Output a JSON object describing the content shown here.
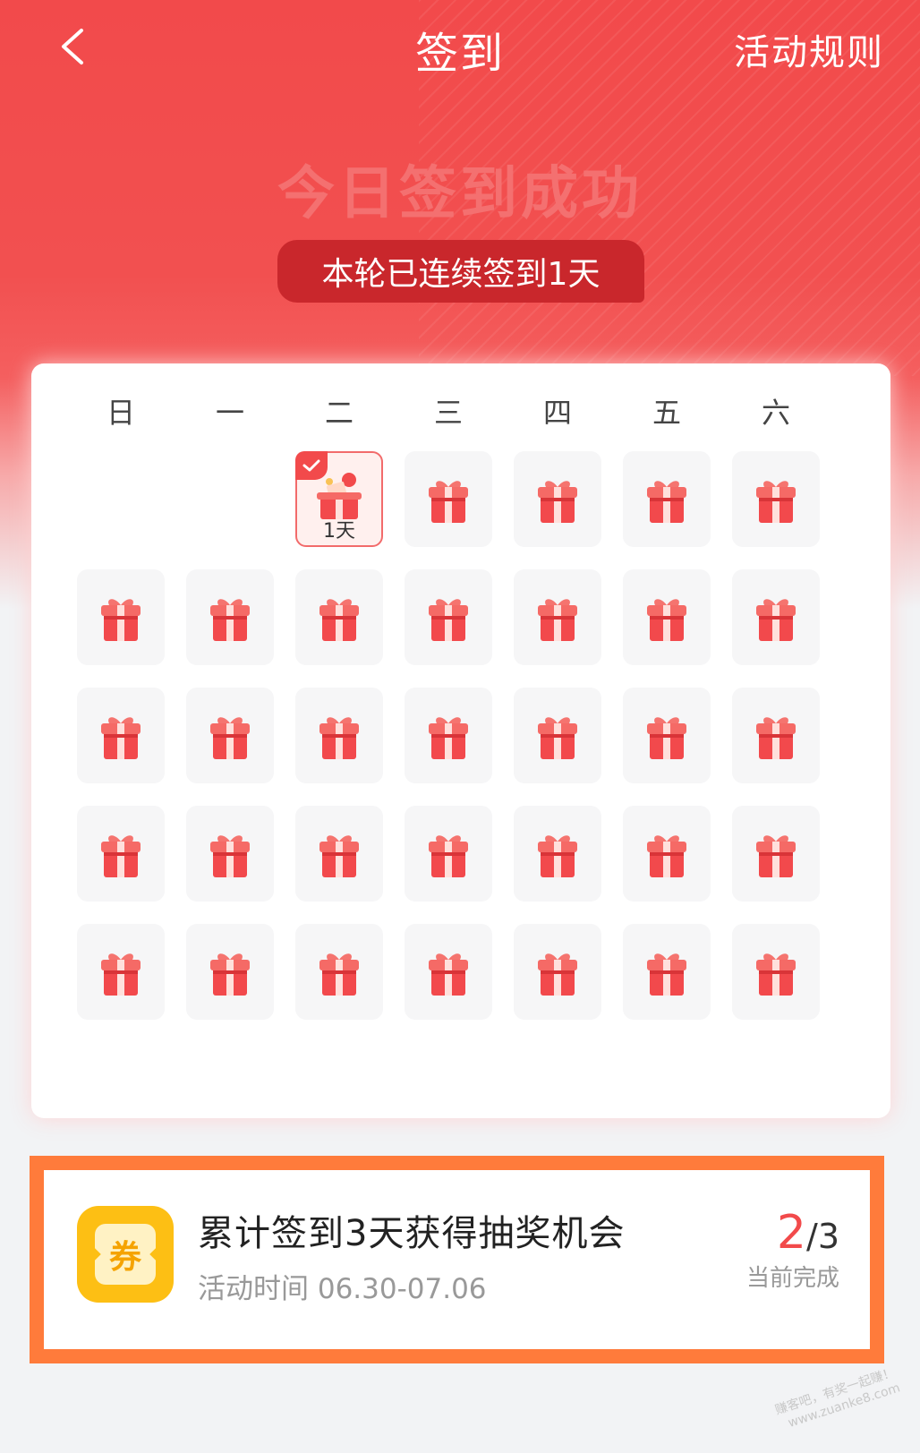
{
  "header": {
    "title": "签到",
    "rules": "活动规则"
  },
  "status": {
    "success": "今日签到成功",
    "streak": "本轮已连续签到1天"
  },
  "calendar": {
    "weekdays": [
      "日",
      "一",
      "二",
      "三",
      "四",
      "五",
      "六"
    ],
    "checked_label": "1天",
    "first_weekday_index": 2,
    "days_total": 33,
    "checked_days": 1
  },
  "task": {
    "icon_char": "券",
    "title": "累计签到3天获得抽奖机会",
    "time": "活动时间 06.30-07.06",
    "progress_done": "2",
    "progress_total": "/3",
    "progress_label": "当前完成"
  },
  "watermark": {
    "line1": "赚客吧，有奖一起赚！",
    "line2": "www.zuanke8.com"
  },
  "colors": {
    "primary": "#f24a4b",
    "accent_orange": "#ff7b3b",
    "coupon_yellow": "#fdbf14"
  }
}
